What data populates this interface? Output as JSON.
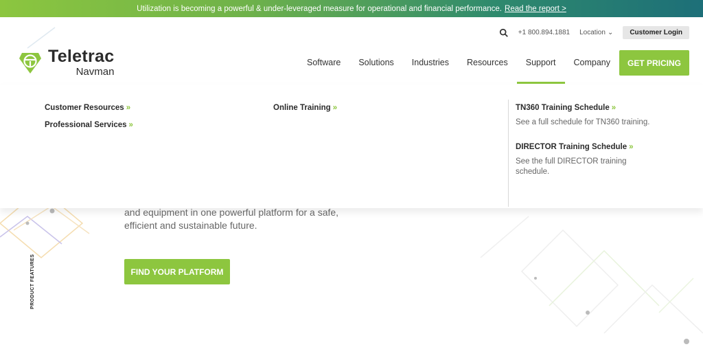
{
  "announcement": {
    "text": "Utilization is becoming a powerful & under-leveraged measure for operational and financial performance.",
    "link_label": "Read the report >"
  },
  "utility": {
    "phone": "+1 800.894.1881",
    "location_label": "Location",
    "login_label": "Customer Login"
  },
  "logo": {
    "brand": "Teletrac",
    "sub": "Navman"
  },
  "nav": {
    "items": [
      "Software",
      "Solutions",
      "Industries",
      "Resources",
      "Support",
      "Company"
    ],
    "active": "Support",
    "cta_label": "GET PRICING"
  },
  "mega": {
    "col1": [
      "Customer Resources",
      "Professional Services"
    ],
    "col2": [
      "Online Training"
    ],
    "col3": [
      {
        "title": "TN360 Training Schedule",
        "desc": "See a full schedule for TN360 training."
      },
      {
        "title": "DIRECTOR Training Schedule",
        "desc": "See the full DIRECTOR training schedule."
      }
    ],
    "arrow": "»"
  },
  "hero": {
    "text": "and equipment in one powerful platform for a safe, efficient and sustainable future.",
    "button_label": "FIND YOUR PLATFORM",
    "vertical_label": "PRODUCT FEATURES"
  },
  "colors": {
    "accent": "#8dc63f"
  }
}
